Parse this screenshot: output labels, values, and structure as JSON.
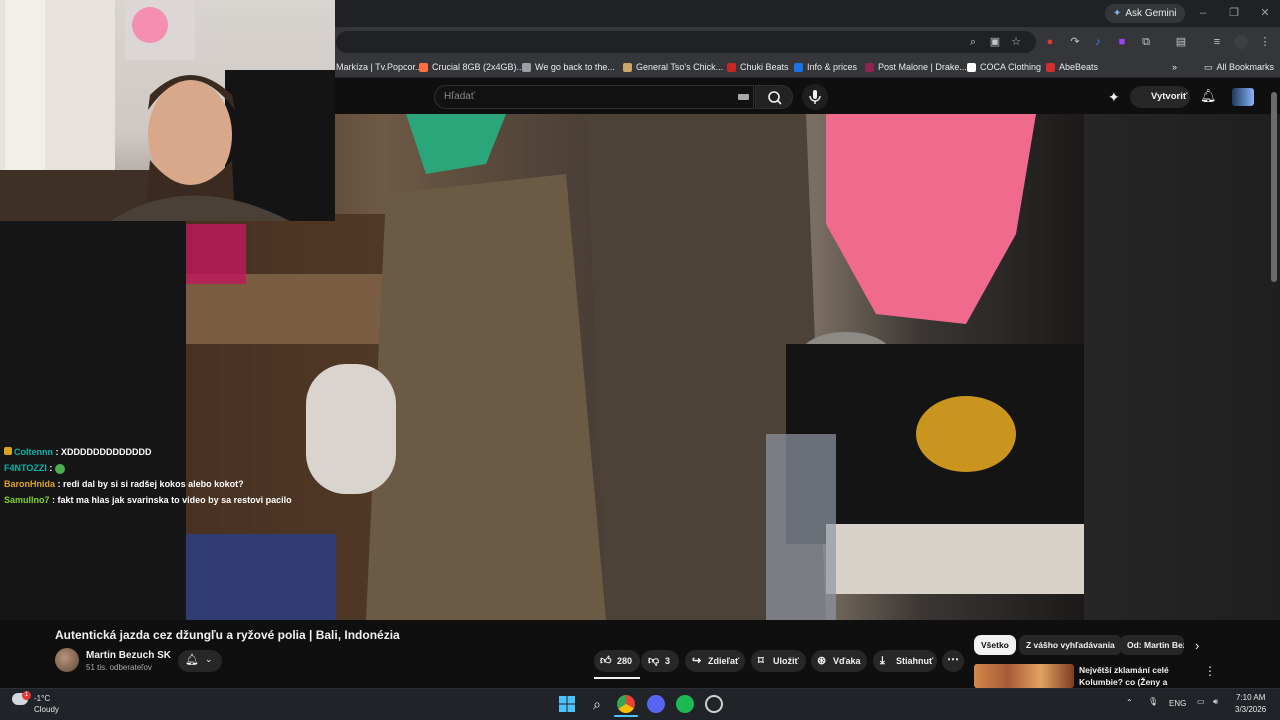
{
  "browser": {
    "ask_gemini": "Ask Gemini",
    "bookmarks": [
      {
        "label": "Markíza | Tv.Popcor...",
        "color": "#e53935"
      },
      {
        "label": "Crucial 8GB (2x4GB)...",
        "color": "#ff7043"
      },
      {
        "label": "We go back to the...",
        "color": "#9aa0a6"
      },
      {
        "label": "General Tso's Chick...",
        "color": "#c9a46b"
      },
      {
        "label": "Chuki Beats",
        "color": "#c62828"
      },
      {
        "label": "Info & prices",
        "color": "#1a73e8"
      },
      {
        "label": "Post Malone | Drake...",
        "color": "#8e244d"
      },
      {
        "label": "COCA Clothing",
        "color": "#ffffff"
      },
      {
        "label": "AbeBeats",
        "color": "#d32f2f"
      }
    ],
    "all_bookmarks": "All Bookmarks"
  },
  "youtube": {
    "search_placeholder": "Hľadať",
    "create_label": "Vytvoriť"
  },
  "chat": {
    "messages": [
      {
        "user": "Coltennn",
        "user_color": "#00b5ad",
        "text": " : XDDDDDDDDDDDDD"
      },
      {
        "user": "F4NTOZZI",
        "user_color": "#00b5ad",
        "text": " : "
      },
      {
        "user": "BaronHnida",
        "user_color": "#daa520",
        "text": " : redi dal by si si radšej kokos alebo kokot?"
      },
      {
        "user": "Samullno7",
        "user_color": "#7ed321",
        "text": " : fakt ma hlas jak svarinska to video by sa restovi pacilo"
      }
    ]
  },
  "video": {
    "title": "Autentická jazda cez džungľu a ryžové polia | Bali, Indonézia",
    "channel": "Martin Bezuch SK",
    "subscribers": "51 tis. odberateľov",
    "likes": "280",
    "dislikes": "3",
    "share": "Zdieľať",
    "save": "Uložiť",
    "thanks": "Vďaka",
    "download": "Stiahnuť"
  },
  "recommendations": {
    "chips": [
      "Všetko",
      "Z vášho vyhľadávania",
      "Od: Martin Bezuch"
    ],
    "first_title": "Největší zklamání celé Kolumbie? co (Ženy a Krádeže)"
  },
  "taskbar": {
    "temperature": "-1°C",
    "weather": "Cloudy",
    "language": "ENG",
    "time": "7:10 AM",
    "date": "3/3/2026",
    "notification_badge": "1"
  }
}
